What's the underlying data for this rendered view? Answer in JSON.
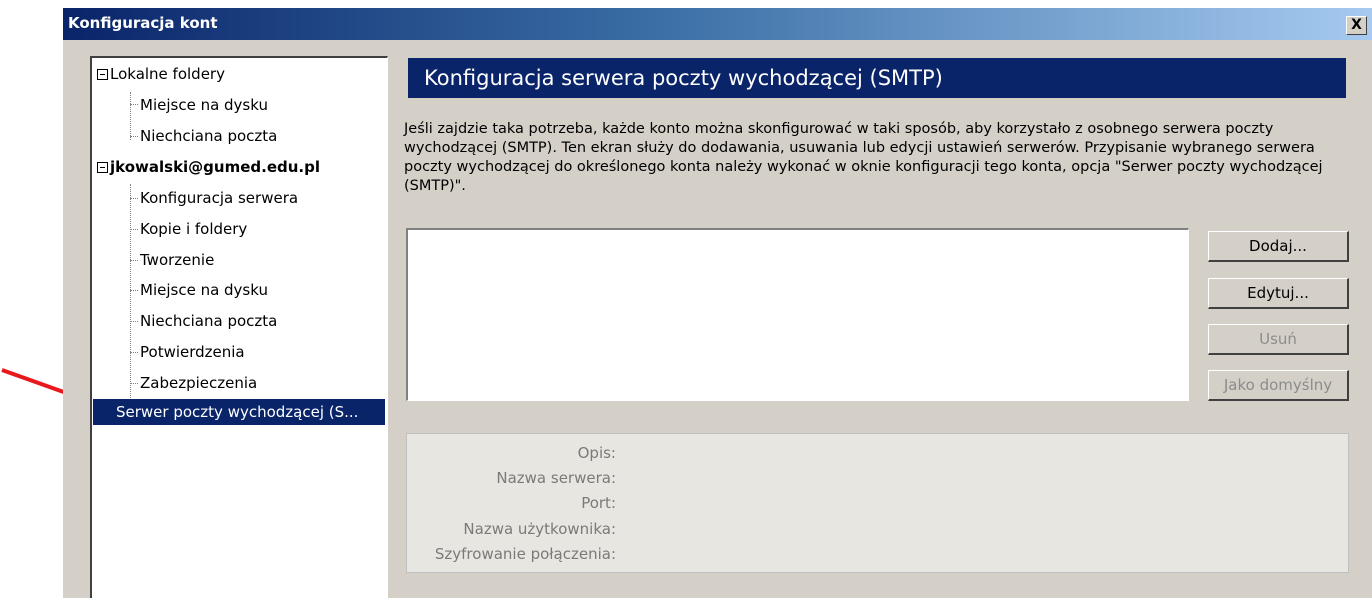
{
  "window": {
    "title": "Konfiguracja kont",
    "close_label": "X"
  },
  "tree": {
    "groups": [
      {
        "label": "Lokalne foldery",
        "children": [
          "Miejsce na dysku",
          "Niechciana poczta"
        ]
      },
      {
        "label": "jkowalski@gumed.edu.pl",
        "children": [
          "Konfiguracja serwera",
          "Kopie i foldery",
          "Tworzenie",
          "Miejsce na dysku",
          "Niechciana poczta",
          "Potwierdzenia",
          "Zabezpieczenia"
        ]
      }
    ],
    "selected": "Serwer poczty wychodzącej (S..."
  },
  "panel": {
    "header": "Konfiguracja serwera poczty wychodzącej (SMTP)",
    "description": "Jeśli zajdzie taka potrzeba, każde konto można skonfigurować w taki sposób, aby korzystało z osobnego serwera poczty wychodzącej (SMTP). Ten ekran służy do dodawania, usuwania lub edycji ustawień serwerów. Przypisanie wybranego serwera poczty wychodzącej do określonego konta należy wykonać w oknie konfiguracji tego konta, opcja \"Serwer poczty wychodzącej (SMTP)\".",
    "buttons": {
      "add": "Dodaj...",
      "edit": "Edytuj...",
      "remove": "Usuń",
      "default": "Jako domyślny"
    },
    "details": {
      "description": "Opis:",
      "server_name": "Nazwa serwera:",
      "port": "Port:",
      "username": "Nazwa użytkownika:",
      "encryption": "Szyfrowanie połączenia:"
    }
  },
  "colors": {
    "accent": "#0a246a",
    "annotation_arrow": "#e8181c"
  }
}
